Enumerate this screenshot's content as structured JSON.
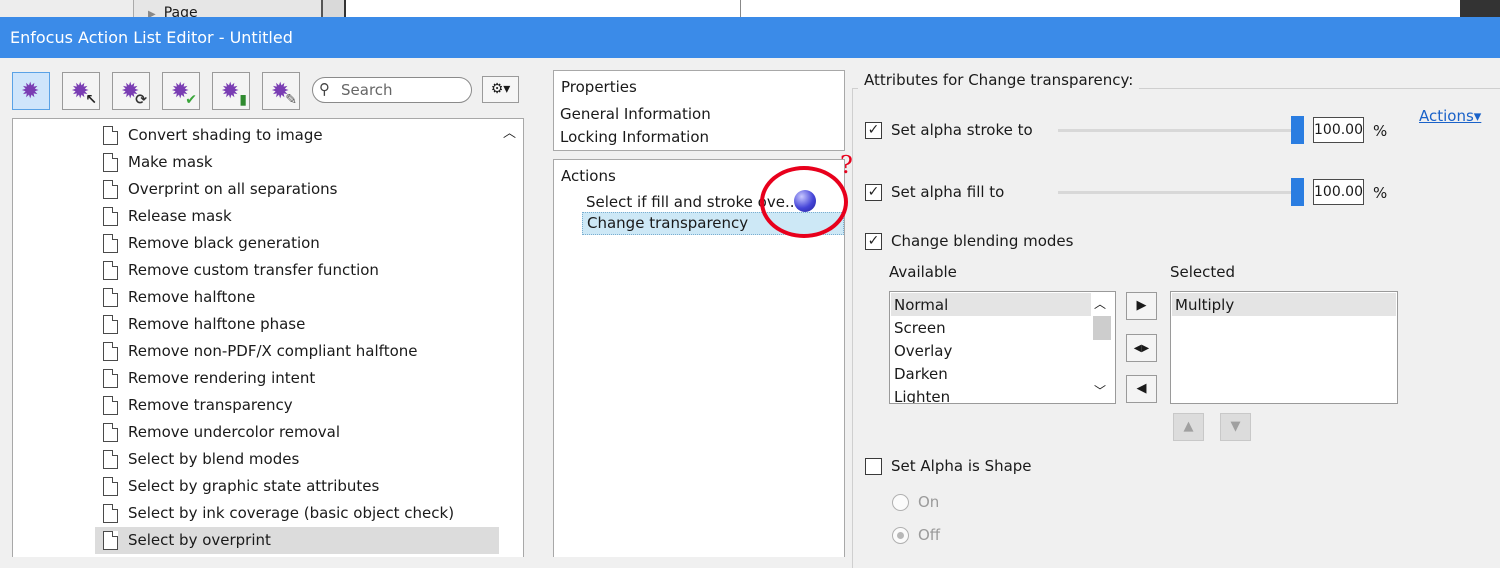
{
  "background_window": {
    "tab_label": "Page"
  },
  "window": {
    "title": "Enfocus Action List Editor - Untitled"
  },
  "toolbar": {
    "tools": [
      {
        "icon": "gear-icon"
      },
      {
        "icon": "gear-cursor-icon"
      },
      {
        "icon": "gear-refresh-icon"
      },
      {
        "icon": "gear-check-icon"
      },
      {
        "icon": "gear-info-icon"
      },
      {
        "icon": "gear-wrench-icon"
      }
    ],
    "search": {
      "placeholder": "Search"
    },
    "settings_glyph": "⚙▾"
  },
  "action_list": {
    "items": [
      {
        "label": "Convert shading to image"
      },
      {
        "label": "Make mask"
      },
      {
        "label": "Overprint on all separations"
      },
      {
        "label": "Release mask"
      },
      {
        "label": "Remove black generation"
      },
      {
        "label": "Remove custom transfer function"
      },
      {
        "label": "Remove halftone"
      },
      {
        "label": "Remove halftone phase"
      },
      {
        "label": "Remove non-PDF/X compliant halftone"
      },
      {
        "label": "Remove rendering intent"
      },
      {
        "label": "Remove transparency"
      },
      {
        "label": "Remove undercolor removal"
      },
      {
        "label": "Select by blend modes"
      },
      {
        "label": "Select by graphic state attributes"
      },
      {
        "label": "Select by ink coverage (basic object check)"
      },
      {
        "label": "Select by overprint",
        "selected": true
      }
    ]
  },
  "properties_panel": {
    "header": "Properties",
    "items": [
      "General Information",
      "Locking Information"
    ]
  },
  "actions_panel": {
    "header": "Actions",
    "items": [
      "Select if fill and stroke ove...",
      "Change transparency"
    ],
    "annotation_mark": "?"
  },
  "attributes": {
    "title": "Attributes for Change transparency:",
    "actions_link": "Actions▾",
    "alpha_stroke": {
      "label": "Set alpha stroke to",
      "checked": true,
      "value": "100.00",
      "unit": "%"
    },
    "alpha_fill": {
      "label": "Set alpha fill to",
      "checked": true,
      "value": "100.00",
      "unit": "%"
    },
    "blending": {
      "label": "Change blending modes",
      "checked": true,
      "available_label": "Available",
      "selected_label": "Selected",
      "available": [
        "Normal",
        "Screen",
        "Overlay",
        "Darken",
        "Lighten"
      ],
      "selected": [
        "Multiply"
      ]
    },
    "alpha_shape": {
      "label": "Set Alpha is Shape",
      "checked": false,
      "options": [
        "On",
        "Off"
      ],
      "selected_option": "Off"
    }
  },
  "colors": {
    "titlebar": "#3b8be8",
    "accent": "#2a7de1",
    "annotation": "#e8001c"
  }
}
